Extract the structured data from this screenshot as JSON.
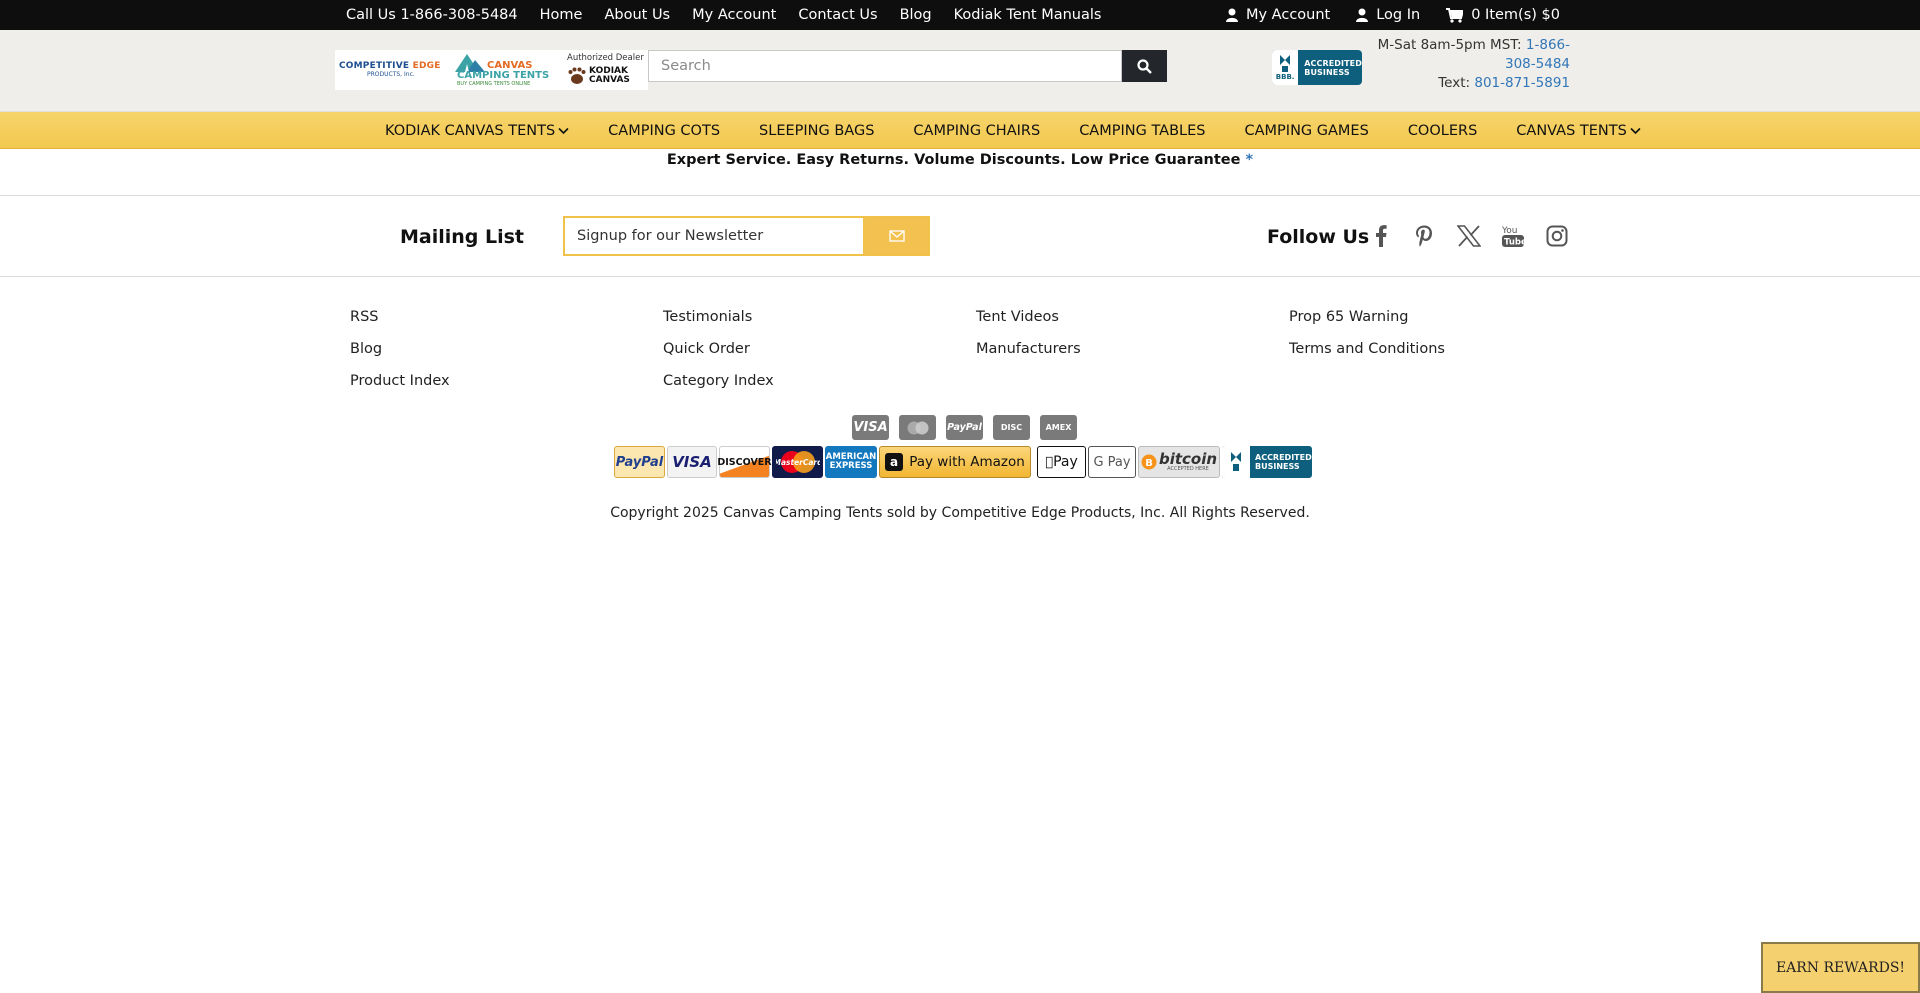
{
  "topbar": {
    "call": "Call Us 1-866-308-5484",
    "links": [
      "Home",
      "About Us",
      "My Account",
      "Contact Us",
      "Blog",
      "Kodiak Tent Manuals"
    ],
    "account": "My Account",
    "login": "Log In",
    "cart": "0 Item(s) $0"
  },
  "logo": {
    "competitive": "COMPETITIVE",
    "edge": "EDGE",
    "products": "PRODUCTS, Inc.",
    "canvas": "CANVAS",
    "camping_tents": "CAMPING TENTS",
    "slogan": "BUY CAMPING TENTS ONLINE",
    "authorized": "Authorized Dealer",
    "kodiak": "KODIAK",
    "kodiak_canvas": "CANVAS"
  },
  "search": {
    "placeholder": "Search"
  },
  "bbb": {
    "seal": "BBB.",
    "line1": "ACCREDITED",
    "line2": "BUSINESS"
  },
  "hours": {
    "label": "M-Sat 8am-5pm MST:",
    "phone_a": "1-866-",
    "phone_b": "308-5484",
    "text_label": "Text:",
    "text_phone": "801-871-5891"
  },
  "nav": {
    "items": [
      "KODIAK CANVAS TENTS",
      "CAMPING COTS",
      "SLEEPING BAGS",
      "CAMPING CHAIRS",
      "CAMPING TABLES",
      "CAMPING GAMES",
      "COOLERS",
      "CANVAS TENTS"
    ]
  },
  "tagline": {
    "text": "Expert Service. Easy Returns. Volume Discounts. Low Price Guarantee",
    "star": "*"
  },
  "mailing": {
    "title": "Mailing List",
    "placeholder": "Signup for our Newsletter"
  },
  "follow": {
    "title": "Follow Us"
  },
  "footer_links": {
    "col1": [
      "RSS",
      "Blog",
      "Product Index"
    ],
    "col2": [
      "Testimonials",
      "Quick Order",
      "Category Index"
    ],
    "col3": [
      "Tent Videos",
      "Manufacturers"
    ],
    "col4": [
      "Prop 65 Warning",
      "Terms and Conditions"
    ]
  },
  "payment_gray": [
    "VISA",
    "MC",
    "PayPal",
    "DISC",
    "AMEX"
  ],
  "payment_badges": {
    "paypal": "PayPal",
    "visa": "VISA",
    "discover": "DISCOVER",
    "mastercard": "MasterCard",
    "amex": "AMERICAN EXPRESS",
    "amazon": "Pay with Amazon",
    "applepay": "Pay",
    "gpay": "G Pay",
    "bitcoin": "bitcoin",
    "bitcoin_sub": "ACCEPTED HERE",
    "bbb_line1": "ACCREDITED",
    "bbb_line2": "BUSINESS"
  },
  "copyright": "Copyright 2025 Canvas Camping Tents sold by Competitive Edge Products, Inc. All Rights Reserved.",
  "rewards": "EARN REWARDS!",
  "colors": {
    "topbar": "#0e0e0e",
    "nav": "#f2c84f",
    "link_blue": "#3276b8",
    "bbb": "#0e5f7d"
  }
}
